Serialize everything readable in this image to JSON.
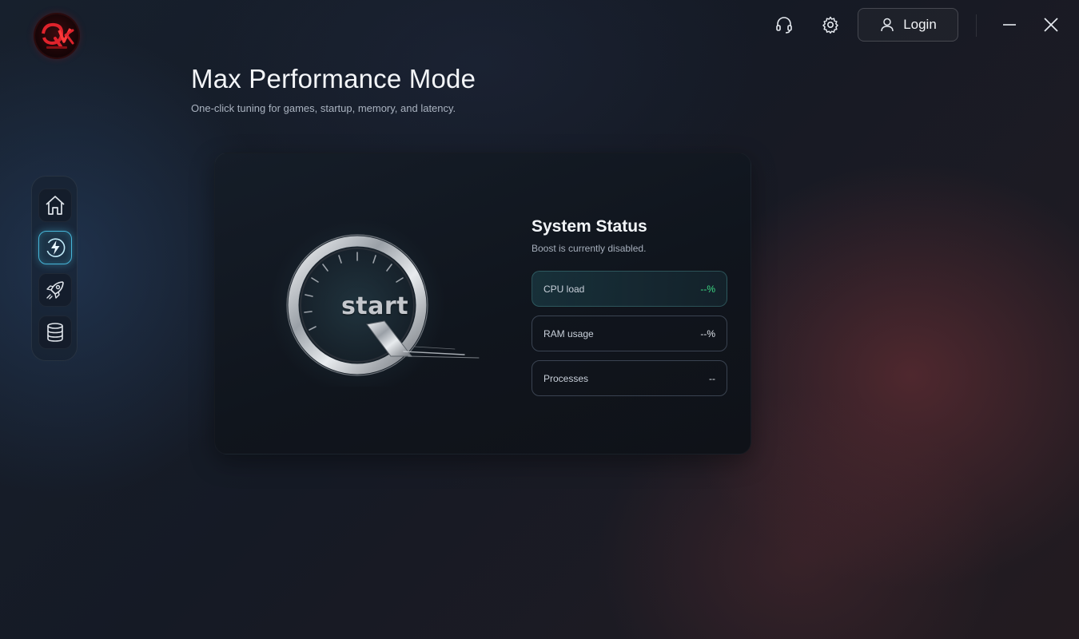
{
  "app": {
    "logo_icon": "qvk-logo-icon"
  },
  "topbar": {
    "support_icon": "headset-icon",
    "settings_icon": "gear-icon",
    "login_label": "Login",
    "login_icon": "user-icon",
    "minimize_icon": "minimize-icon",
    "close_icon": "close-icon"
  },
  "header": {
    "title": "Max Performance Mode",
    "subtitle": "One-click tuning for games, startup, memory, and latency."
  },
  "sidebar": {
    "items": [
      {
        "icon": "home-icon",
        "active": false
      },
      {
        "icon": "lightning-icon",
        "active": true
      },
      {
        "icon": "rocket-icon",
        "active": false
      },
      {
        "icon": "database-icon",
        "active": false
      }
    ]
  },
  "boost": {
    "start_label": "start",
    "status_title": "System Status",
    "status_text": "Boost is currently disabled.",
    "stats": [
      {
        "label": "CPU load",
        "value": "--%"
      },
      {
        "label": "RAM usage",
        "value": "--%"
      },
      {
        "label": "Processes",
        "value": "--"
      }
    ]
  },
  "colors": {
    "accent": "#46b6d9",
    "positive": "#3ddc84",
    "brand": "#d0161f"
  }
}
